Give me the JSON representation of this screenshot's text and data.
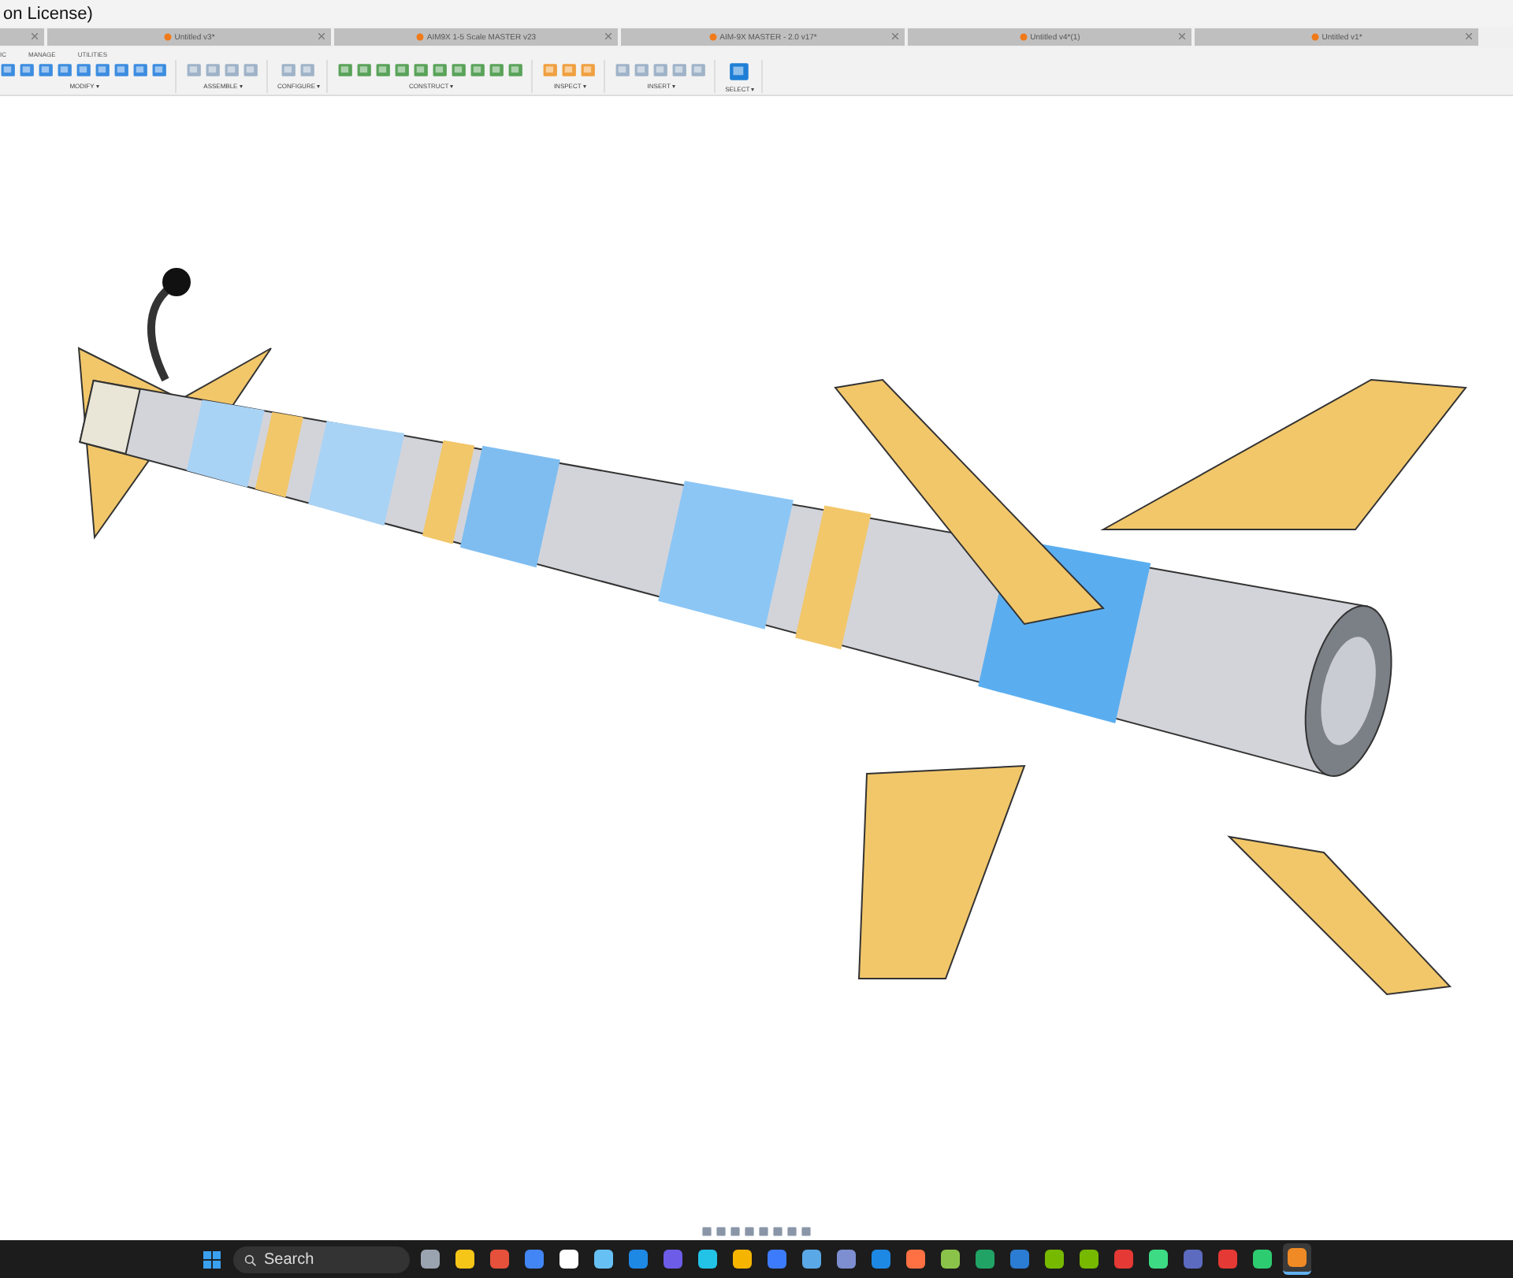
{
  "window": {
    "title": "on License)"
  },
  "document_tabs": [
    {
      "selected": false
    },
    {
      "label": "Untitled v3*",
      "selected": false
    },
    {
      "label": "AIM9X 1-5 Scale MASTER v23",
      "selected": false
    },
    {
      "label": "AIM-9X MASTER - 2.0 v17*",
      "selected": false
    },
    {
      "label": "Untitled v4*(1)",
      "selected": false
    },
    {
      "label": "Untitled v1*",
      "selected": false
    }
  ],
  "workspace_tabs": [
    "IC",
    "MANAGE",
    "UTILITIES"
  ],
  "ribbon_groups": [
    {
      "label": "MODIFY ▾"
    },
    {
      "label": "ASSEMBLE ▾"
    },
    {
      "label": "CONFIGURE ▾"
    },
    {
      "label": "CONSTRUCT ▾"
    },
    {
      "label": "INSPECT ▾"
    },
    {
      "label": "INSERT ▾"
    },
    {
      "label": "SELECT ▾"
    }
  ],
  "taskbar": {
    "search": {
      "placeholder": "Search"
    }
  }
}
